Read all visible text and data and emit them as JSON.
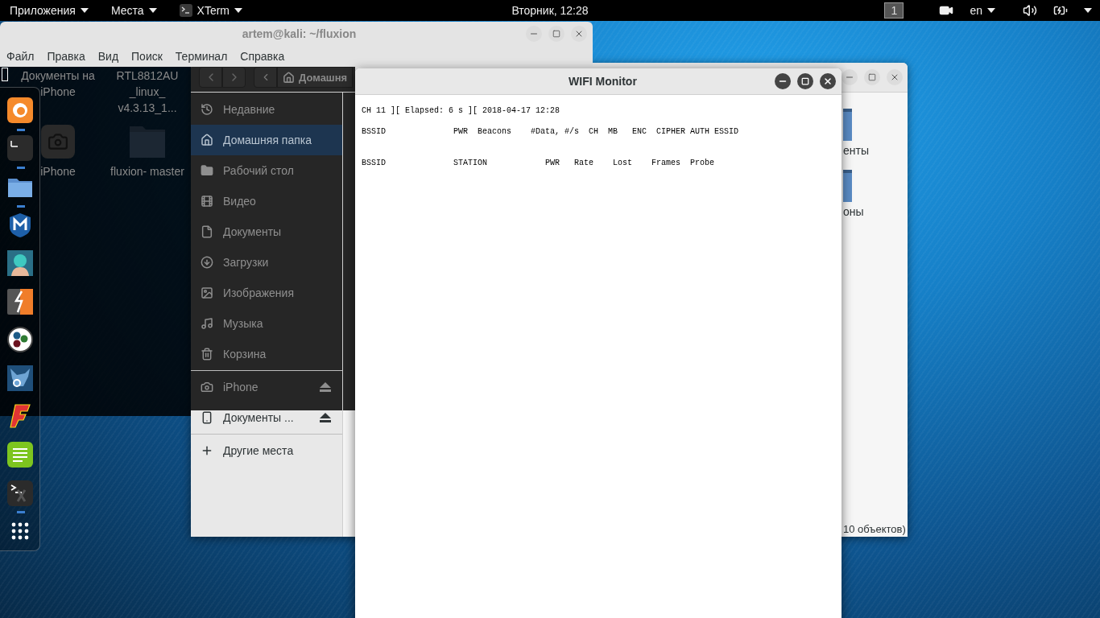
{
  "top_bar": {
    "menus": [
      {
        "label": "Приложения",
        "kind": "menu"
      },
      {
        "label": "Места",
        "kind": "menu"
      },
      {
        "label": "XTerm",
        "kind": "app"
      }
    ],
    "clock": "Вторник, 12:28",
    "workspace": "1",
    "language": "en"
  },
  "desktop_icons": [
    {
      "label": "Документы на iPhone",
      "kind": "label"
    },
    {
      "label": "RTL8812AU _linux_ v4.3.13_1...",
      "kind": "label"
    },
    {
      "label": "iPhone",
      "kind": "camera"
    },
    {
      "label": "fluxion- master",
      "kind": "folder"
    }
  ],
  "dock": {
    "apps": [
      {
        "kind": "firefox",
        "running": true
      },
      {
        "kind": "terminal",
        "running": true
      },
      {
        "kind": "files",
        "running": true
      },
      {
        "kind": "metasploit",
        "running": false
      },
      {
        "kind": "avatar",
        "running": false
      },
      {
        "kind": "burp",
        "running": false
      },
      {
        "kind": "maltego",
        "running": false
      },
      {
        "kind": "beef",
        "running": false
      },
      {
        "kind": "faraday",
        "running": false
      },
      {
        "kind": "notes",
        "running": false
      },
      {
        "kind": "xterm",
        "running": true
      },
      {
        "kind": "grid",
        "running": false
      }
    ]
  },
  "file_manager": {
    "path_button": "Домашня",
    "sidebar": {
      "sections": [
        {
          "items": [
            {
              "label": "Недавние",
              "kind": "recent",
              "selected": false,
              "ejectable": false
            },
            {
              "label": "Домашняя папка",
              "kind": "home",
              "selected": true,
              "ejectable": false
            },
            {
              "label": "Рабочий стол",
              "kind": "desktop",
              "selected": false,
              "ejectable": false
            },
            {
              "label": "Видео",
              "kind": "video",
              "selected": false,
              "ejectable": false
            },
            {
              "label": "Документы",
              "kind": "documents",
              "selected": false,
              "ejectable": false
            },
            {
              "label": "Загрузки",
              "kind": "downloads",
              "selected": false,
              "ejectable": false
            },
            {
              "label": "Изображения",
              "kind": "pictures",
              "selected": false,
              "ejectable": false
            },
            {
              "label": "Музыка",
              "kind": "music",
              "selected": false,
              "ejectable": false
            },
            {
              "label": "Корзина",
              "kind": "trash",
              "selected": false,
              "ejectable": false
            }
          ]
        },
        {
          "items": [
            {
              "label": "iPhone",
              "kind": "camera",
              "selected": false,
              "ejectable": true
            },
            {
              "label": "Документы ...",
              "kind": "phone",
              "selected": false,
              "ejectable": true
            }
          ]
        },
        {
          "items": [
            {
              "label": "Другие места",
              "kind": "other",
              "selected": false,
              "ejectable": false
            }
          ]
        }
      ]
    },
    "folders": [
      {
        "label": "енты"
      },
      {
        "label": "оны"
      }
    ],
    "status": "10 объектов)"
  },
  "xterm": {
    "title": "artem@kali: ~/fluxion",
    "menu": [
      "Файл",
      "Правка",
      "Вид",
      "Поиск",
      "Терминал",
      "Справка"
    ]
  },
  "wifi_monitor": {
    "title": "WIFI Monitor",
    "lines": [
      "CH 11 ][ Elapsed: 6 s ][ 2018-04-17 12:28",
      "BSSID              PWR  Beacons    #Data, #/s  CH  MB   ENC  CIPHER AUTH ESSID",
      "BSSID              STATION            PWR   Rate    Lost    Frames  Probe"
    ]
  }
}
